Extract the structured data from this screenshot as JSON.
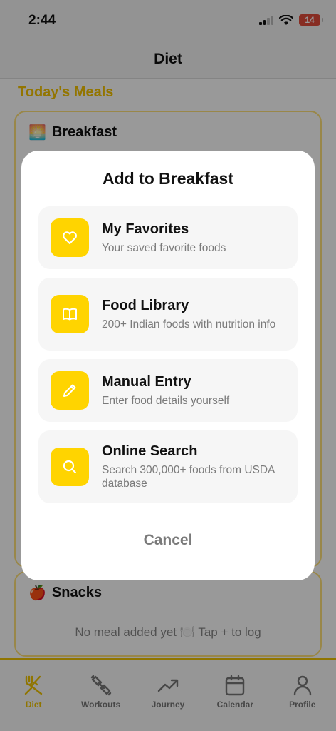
{
  "status_bar": {
    "time": "2:44",
    "battery": "14",
    "icons": [
      "signal-icon",
      "wifi-icon",
      "battery-icon"
    ]
  },
  "nav": {
    "title": "Diet"
  },
  "page": {
    "section_title": "Today's Meals"
  },
  "meals": {
    "breakfast": {
      "emoji": "🌅",
      "label": "Breakfast"
    },
    "snacks": {
      "emoji": "🍎",
      "label": "Snacks",
      "empty_text": "No meal added yet 🍽️ Tap + to log"
    }
  },
  "modal": {
    "title": "Add to Breakfast",
    "options": [
      {
        "title": "My Favorites",
        "subtitle": "Your saved favorite foods",
        "icon": "heart-icon"
      },
      {
        "title": "Food Library",
        "subtitle": "200+ Indian foods with nutrition info",
        "icon": "book-icon"
      },
      {
        "title": "Manual Entry",
        "subtitle": "Enter food details yourself",
        "icon": "pencil-icon"
      },
      {
        "title": "Online Search",
        "subtitle": "Search 300,000+ foods from USDA database",
        "icon": "search-icon"
      }
    ],
    "cancel_label": "Cancel"
  },
  "tabs": [
    {
      "label": "Diet",
      "icon": "fork-knife-icon",
      "active": true
    },
    {
      "label": "Workouts",
      "icon": "dumbbell-icon",
      "active": false
    },
    {
      "label": "Journey",
      "icon": "trend-icon",
      "active": false
    },
    {
      "label": "Calendar",
      "icon": "calendar-icon",
      "active": false
    },
    {
      "label": "Profile",
      "icon": "person-icon",
      "active": false
    }
  ],
  "colors": {
    "accent": "#ffd400",
    "active_tab": "#f0c400",
    "scrim": "rgba(0,0,0,0.40)"
  }
}
